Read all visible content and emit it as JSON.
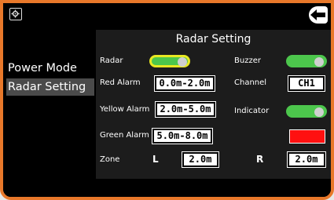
{
  "menu": {
    "items": [
      "Power Mode",
      "Radar Setting"
    ],
    "active_index": 1
  },
  "panel": {
    "title": "Radar Setting",
    "radar_label": "Radar",
    "radar_on": true,
    "buzzer_label": "Buzzer",
    "buzzer_on": true,
    "red_alarm_label": "Red Alarm",
    "red_alarm_value": "0.0m-2.0m",
    "channel_label": "Channel",
    "channel_value": "CH1",
    "yellow_alarm_label": "Yellow Alarm",
    "yellow_alarm_value": "2.0m-5.0m",
    "indicator_label": "Indicator",
    "indicator_on": true,
    "green_alarm_label": "Green Alarm",
    "green_alarm_value": "5.0m-8.0m",
    "indicator_color": "#ff1010",
    "zone_label": "Zone",
    "zone_left_label": "L",
    "zone_left_value": "2.0m",
    "zone_right_label": "R",
    "zone_right_value": "2.0m"
  },
  "colors": {
    "frame_accent": "#e8782a",
    "toggle_on": "#4cc64c",
    "selection_highlight": "#e8e822"
  },
  "icons": {
    "settings": "gear-icon",
    "back": "back-arrow-icon"
  }
}
